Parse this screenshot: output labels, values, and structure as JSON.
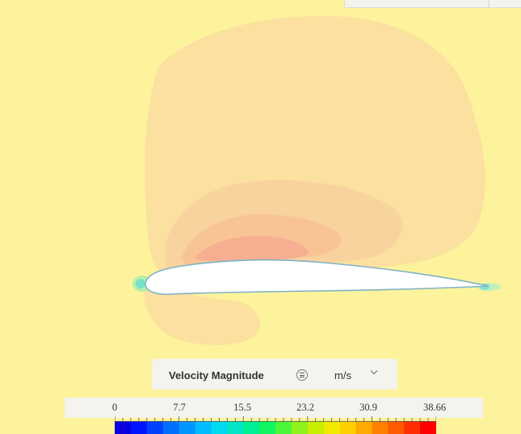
{
  "field": {
    "name": "Velocity Magnitude",
    "unit": "m/s"
  },
  "legend": {
    "ticks": [
      "0",
      "7.7",
      "15.5",
      "23.2",
      "30.9",
      "38.66"
    ],
    "colors": [
      "#0a00e0",
      "#0015ff",
      "#0040ff",
      "#0070ff",
      "#0095ff",
      "#00bbff",
      "#00d9f0",
      "#00e5c4",
      "#00ef93",
      "#10f560",
      "#4cf638",
      "#8ef21c",
      "#c8ee00",
      "#f0ea00",
      "#ffd000",
      "#ffab00",
      "#ff8000",
      "#ff5a00",
      "#ff2f00",
      "#ff0000"
    ]
  },
  "colors": {
    "freestream": "#fcf39c",
    "contour_outer": "#fbe0a0",
    "contour_mid": "#f9d39e",
    "contour_inner": "#f8c496",
    "contour_core": "#f6b091",
    "airfoil": "#ffffff"
  }
}
